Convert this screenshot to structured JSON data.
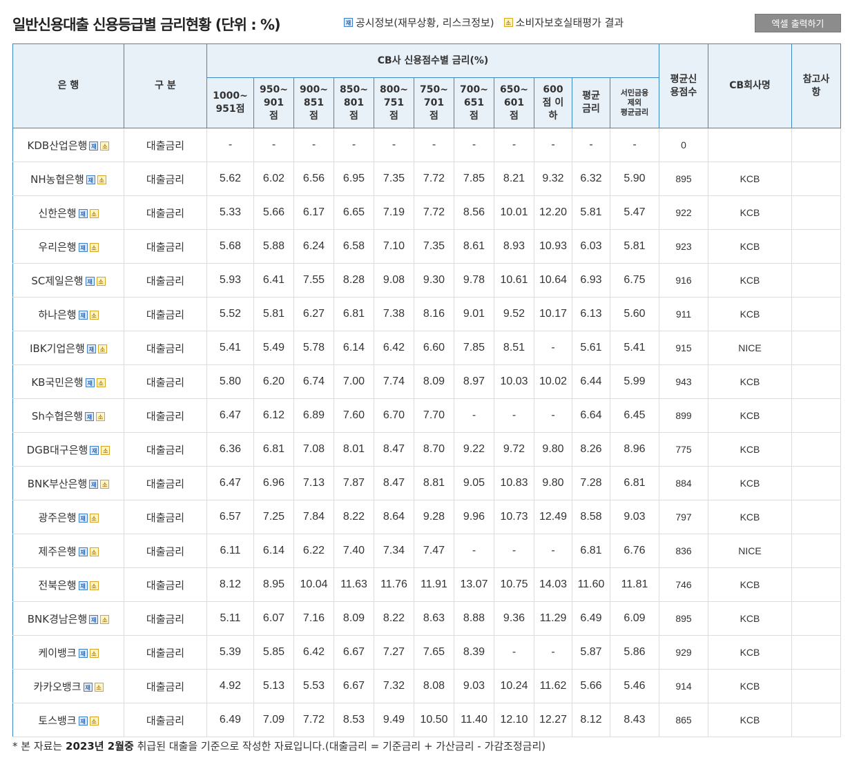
{
  "page_title": "일반신용대출 신용등급별 금리현황 (단위 : %)",
  "legend": {
    "disclosure_icon": "재",
    "disclosure_label": "공시정보(재무상황, 리스크정보)",
    "consumer_icon": "소",
    "consumer_label": "소비자보호실태평가 결과"
  },
  "excel_button": "엑셀 출력하기",
  "colors": {
    "header_border": "#3d86c6",
    "header_bg": "#e8f0f8",
    "button_bg": "#8c8c8c"
  },
  "table": {
    "headers": {
      "bank": "은 행",
      "category": "구 분",
      "group": "CB사 신용점수별 금리(%)",
      "score_cols": [
        "1000~\n951점",
        "950~\n901\n점",
        "900~\n851\n점",
        "850~\n801\n점",
        "800~\n751\n점",
        "750~\n701\n점",
        "700~\n651\n점",
        "650~\n601\n점",
        "600\n점 이\n하",
        "평균\n금리",
        "서민금융\n제외\n평균금리"
      ],
      "avg_score": "평균신\n용점수",
      "cb_name": "CB회사명",
      "note": "참고사\n항"
    },
    "rows": [
      {
        "bank": "KDB산업은행",
        "category": "대출금리",
        "rates": [
          "-",
          "-",
          "-",
          "-",
          "-",
          "-",
          "-",
          "-",
          "-",
          "-",
          "-"
        ],
        "avg_score": "0",
        "cb": "",
        "note": ""
      },
      {
        "bank": "NH농협은행",
        "category": "대출금리",
        "rates": [
          "5.62",
          "6.02",
          "6.56",
          "6.95",
          "7.35",
          "7.72",
          "7.85",
          "8.21",
          "9.32",
          "6.32",
          "5.90"
        ],
        "avg_score": "895",
        "cb": "KCB",
        "note": ""
      },
      {
        "bank": "신한은행",
        "category": "대출금리",
        "rates": [
          "5.33",
          "5.66",
          "6.17",
          "6.65",
          "7.19",
          "7.72",
          "8.56",
          "10.01",
          "12.20",
          "5.81",
          "5.47"
        ],
        "avg_score": "922",
        "cb": "KCB",
        "note": ""
      },
      {
        "bank": "우리은행",
        "category": "대출금리",
        "rates": [
          "5.68",
          "5.88",
          "6.24",
          "6.58",
          "7.10",
          "7.35",
          "8.61",
          "8.93",
          "10.93",
          "6.03",
          "5.81"
        ],
        "avg_score": "923",
        "cb": "KCB",
        "note": ""
      },
      {
        "bank": "SC제일은행",
        "category": "대출금리",
        "rates": [
          "5.93",
          "6.41",
          "7.55",
          "8.28",
          "9.08",
          "9.30",
          "9.78",
          "10.61",
          "10.64",
          "6.93",
          "6.75"
        ],
        "avg_score": "916",
        "cb": "KCB",
        "note": ""
      },
      {
        "bank": "하나은행",
        "category": "대출금리",
        "rates": [
          "5.52",
          "5.81",
          "6.27",
          "6.81",
          "7.38",
          "8.16",
          "9.01",
          "9.52",
          "10.17",
          "6.13",
          "5.60"
        ],
        "avg_score": "911",
        "cb": "KCB",
        "note": ""
      },
      {
        "bank": "IBK기업은행",
        "category": "대출금리",
        "rates": [
          "5.41",
          "5.49",
          "5.78",
          "6.14",
          "6.42",
          "6.60",
          "7.85",
          "8.51",
          "-",
          "5.61",
          "5.41"
        ],
        "avg_score": "915",
        "cb": "NICE",
        "note": ""
      },
      {
        "bank": "KB국민은행",
        "category": "대출금리",
        "rates": [
          "5.80",
          "6.20",
          "6.74",
          "7.00",
          "7.74",
          "8.09",
          "8.97",
          "10.03",
          "10.02",
          "6.44",
          "5.99"
        ],
        "avg_score": "943",
        "cb": "KCB",
        "note": ""
      },
      {
        "bank": "Sh수협은행",
        "category": "대출금리",
        "rates": [
          "6.47",
          "6.12",
          "6.89",
          "7.60",
          "6.70",
          "7.70",
          "-",
          "-",
          "-",
          "6.64",
          "6.45"
        ],
        "avg_score": "899",
        "cb": "KCB",
        "note": ""
      },
      {
        "bank": "DGB대구은행",
        "category": "대출금리",
        "rates": [
          "6.36",
          "6.81",
          "7.08",
          "8.01",
          "8.47",
          "8.70",
          "9.22",
          "9.72",
          "9.80",
          "8.26",
          "8.96"
        ],
        "avg_score": "775",
        "cb": "KCB",
        "note": ""
      },
      {
        "bank": "BNK부산은행",
        "category": "대출금리",
        "rates": [
          "6.47",
          "6.96",
          "7.13",
          "7.87",
          "8.47",
          "8.81",
          "9.05",
          "10.83",
          "9.80",
          "7.28",
          "6.81"
        ],
        "avg_score": "884",
        "cb": "KCB",
        "note": ""
      },
      {
        "bank": "광주은행",
        "category": "대출금리",
        "rates": [
          "6.57",
          "7.25",
          "7.84",
          "8.22",
          "8.64",
          "9.28",
          "9.96",
          "10.73",
          "12.49",
          "8.58",
          "9.03"
        ],
        "avg_score": "797",
        "cb": "KCB",
        "note": ""
      },
      {
        "bank": "제주은행",
        "category": "대출금리",
        "rates": [
          "6.11",
          "6.14",
          "6.22",
          "7.40",
          "7.34",
          "7.47",
          "-",
          "-",
          "-",
          "6.81",
          "6.76"
        ],
        "avg_score": "836",
        "cb": "NICE",
        "note": ""
      },
      {
        "bank": "전북은행",
        "category": "대출금리",
        "rates": [
          "8.12",
          "8.95",
          "10.04",
          "11.63",
          "11.76",
          "11.91",
          "13.07",
          "10.75",
          "14.03",
          "11.60",
          "11.81"
        ],
        "avg_score": "746",
        "cb": "KCB",
        "note": ""
      },
      {
        "bank": "BNK경남은행",
        "category": "대출금리",
        "rates": [
          "5.11",
          "6.07",
          "7.16",
          "8.09",
          "8.22",
          "8.63",
          "8.88",
          "9.36",
          "11.29",
          "6.49",
          "6.09"
        ],
        "avg_score": "895",
        "cb": "KCB",
        "note": ""
      },
      {
        "bank": "케이뱅크",
        "category": "대출금리",
        "rates": [
          "5.39",
          "5.85",
          "6.42",
          "6.67",
          "7.27",
          "7.65",
          "8.39",
          "-",
          "-",
          "5.87",
          "5.86"
        ],
        "avg_score": "929",
        "cb": "KCB",
        "note": ""
      },
      {
        "bank": "카카오뱅크",
        "category": "대출금리",
        "rates": [
          "4.92",
          "5.13",
          "5.53",
          "6.67",
          "7.32",
          "8.08",
          "9.03",
          "10.24",
          "11.62",
          "5.66",
          "5.46"
        ],
        "avg_score": "914",
        "cb": "KCB",
        "note": ""
      },
      {
        "bank": "토스뱅크",
        "category": "대출금리",
        "rates": [
          "6.49",
          "7.09",
          "7.72",
          "8.53",
          "9.49",
          "10.50",
          "11.40",
          "12.10",
          "12.27",
          "8.12",
          "8.43"
        ],
        "avg_score": "865",
        "cb": "KCB",
        "note": ""
      }
    ]
  },
  "footnote": {
    "prefix": "* 본 자료는 ",
    "highlight": "2023년 2월중",
    "suffix": " 취급된 대출을 기준으로 작성한 자료입니다.(대출금리 = 기준금리 + 가산금리 - 가감조정금리)"
  }
}
